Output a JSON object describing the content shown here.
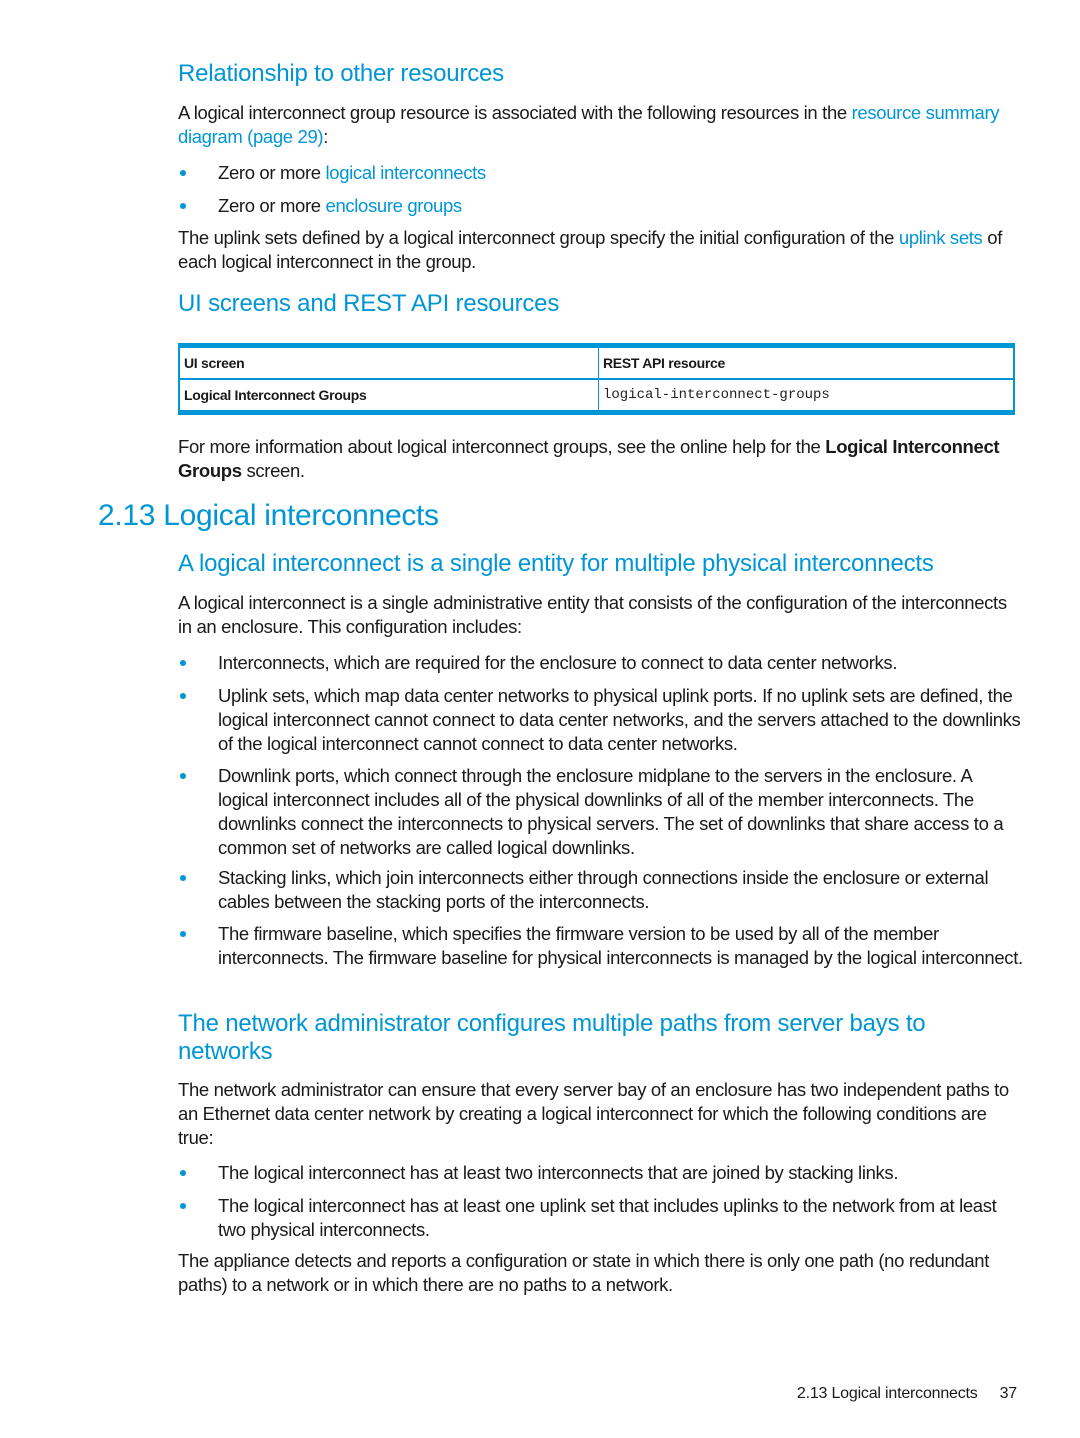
{
  "section_relationship": {
    "heading": "Relationship to other resources",
    "intro_text": "A logical interconnect group resource is associated with the following resources in the ",
    "intro_link": "resource summary diagram (page 29)",
    "intro_end": ":",
    "bullets": [
      {
        "prefix": "Zero or more ",
        "link": "logical interconnects"
      },
      {
        "prefix": "Zero or more ",
        "link": "enclosure groups"
      }
    ],
    "uplink_text_1": "The uplink sets defined by a logical interconnect group specify the initial configuration of the ",
    "uplink_link": "uplink sets",
    "uplink_text_2": " of each logical interconnect in the group."
  },
  "section_ui_rest": {
    "heading": "UI screens and REST API resources",
    "table": {
      "headers": [
        "UI screen",
        "REST API resource"
      ],
      "rows": [
        [
          "Logical Interconnect Groups",
          "logical-interconnect-groups"
        ]
      ]
    },
    "more_info_text": "For more information about logical interconnect groups, see the online help for the ",
    "more_info_bold": "Logical Interconnect Groups",
    "more_info_end": " screen."
  },
  "section_2_13": {
    "title": "2.13 Logical interconnects",
    "sub1": {
      "heading": "A logical interconnect is a single entity for multiple physical interconnects",
      "intro": "A logical interconnect is a single administrative entity that consists of the configuration of the interconnects in an enclosure. This configuration includes:",
      "bullets": [
        "Interconnects, which are required for the enclosure to connect to data center networks.",
        "Uplink sets, which map data center networks to physical uplink ports. If no uplink sets are defined, the logical interconnect cannot connect to data center networks, and the servers attached to the downlinks of the logical interconnect cannot connect to data center networks.",
        "Downlink ports, which connect through the enclosure midplane to the servers in the enclosure. A logical interconnect includes all of the physical downlinks of all of the member interconnects. The downlinks connect the interconnects to physical servers. The set of downlinks that share access to a common set of networks are called logical downlinks.",
        "Stacking links, which join interconnects either through connections inside the enclosure or external cables between the stacking ports of the interconnects.",
        "The firmware baseline, which specifies the firmware version to be used by all of the member interconnects. The firmware baseline for physical interconnects is managed by the logical interconnect."
      ]
    },
    "sub2": {
      "heading": "The network administrator configures multiple paths from server bays to networks",
      "intro": "The network administrator can ensure that every server bay of an enclosure has two independent paths to an Ethernet data center network by creating a logical interconnect for which the following conditions are true:",
      "bullets": [
        "The logical interconnect has at least two interconnects that are joined by stacking links.",
        "The logical interconnect has at least one uplink set that includes uplinks to the network from at least two physical interconnects."
      ],
      "closing": "The appliance detects and reports a configuration or state in which there is only one path (no redundant paths) to a network or in which there are no paths to a network."
    }
  },
  "footer": {
    "section": "2.13 Logical interconnects",
    "page_number": "37"
  },
  "colors": {
    "accent": "#0096d6",
    "text": "#1a1a1a"
  }
}
